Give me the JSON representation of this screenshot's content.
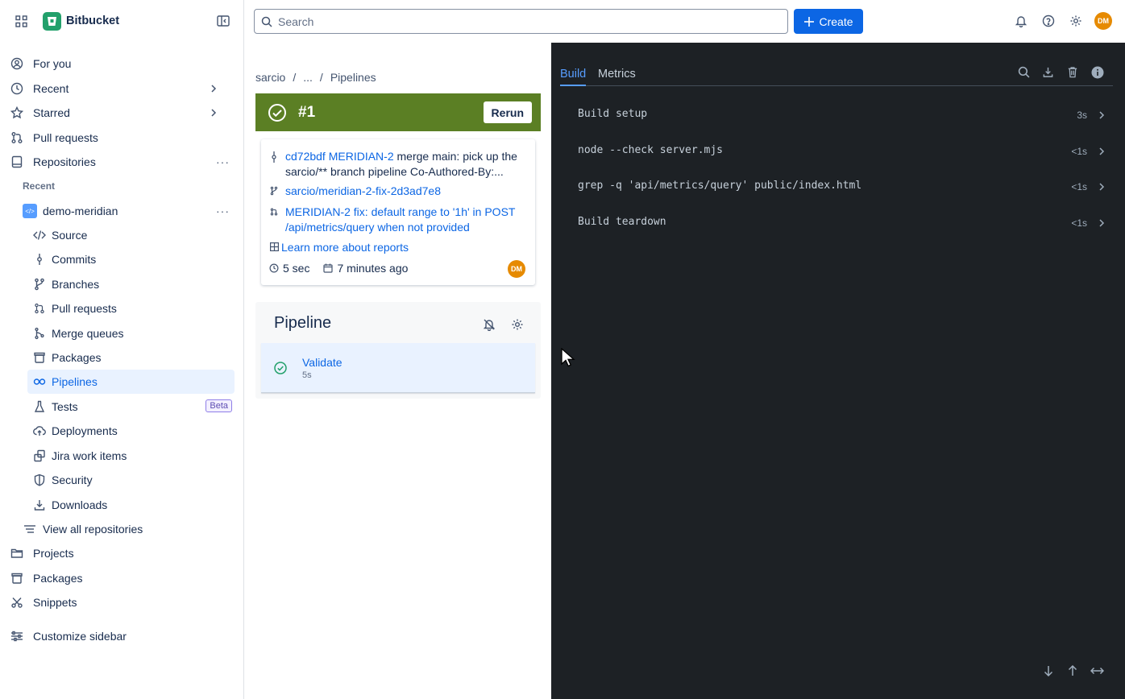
{
  "app": {
    "name": "Bitbucket"
  },
  "search": {
    "placeholder": "Search"
  },
  "topbar": {
    "create_label": "Create",
    "avatar_initials": "DM"
  },
  "sidebar": {
    "for_you": "For you",
    "recent": "Recent",
    "starred": "Starred",
    "pull_requests": "Pull requests",
    "repositories": "Repositories",
    "recent_heading": "Recent",
    "repo_name": "demo-meridian",
    "repo_items": [
      {
        "label": "Source"
      },
      {
        "label": "Commits"
      },
      {
        "label": "Branches"
      },
      {
        "label": "Pull requests"
      },
      {
        "label": "Merge queues"
      },
      {
        "label": "Packages"
      },
      {
        "label": "Pipelines"
      },
      {
        "label": "Tests",
        "badge": "Beta"
      },
      {
        "label": "Deployments"
      },
      {
        "label": "Jira work items"
      },
      {
        "label": "Security"
      },
      {
        "label": "Downloads"
      }
    ],
    "view_all": "View all repositories",
    "projects": "Projects",
    "packages": "Packages",
    "snippets": "Snippets",
    "customize": "Customize sidebar"
  },
  "breadcrumb": {
    "root": "sarcio",
    "sep": "/",
    "ellipsis": "...",
    "current": "Pipelines"
  },
  "run": {
    "number": "#1",
    "rerun_label": "Rerun",
    "commit_hash": "cd72bdf",
    "commit_ref": "MERIDIAN-2",
    "commit_msg_1": "merge main: pick up the",
    "commit_msg_2": "sarcio/** branch pipeline Co-Authored-By:...",
    "branch": "sarcio/meridian-2-fix-2d3ad7e8",
    "pr_line_1": "MERIDIAN-2 fix: default range to '1h' in POST",
    "pr_line_2": "/api/metrics/query when not provided",
    "reports_link": "Learn more about reports",
    "duration": "5 sec",
    "when": "7 minutes ago",
    "author_initials": "DM"
  },
  "pipeline": {
    "title": "Pipeline",
    "step_name": "Validate",
    "step_duration": "5s"
  },
  "log_panel": {
    "tabs": [
      "Build",
      "Metrics"
    ],
    "rows": [
      {
        "cmd": "Build setup",
        "time": "3s"
      },
      {
        "cmd": "node --check server.mjs",
        "time": "<1s"
      },
      {
        "cmd": "grep -q 'api/metrics/query' public/index.html",
        "time": "<1s"
      },
      {
        "cmd": "Build teardown",
        "time": "<1s"
      }
    ]
  },
  "colors": {
    "accent": "#0c66e4",
    "success_banner": "#5b7f24",
    "log_bg": "#1d2125"
  }
}
